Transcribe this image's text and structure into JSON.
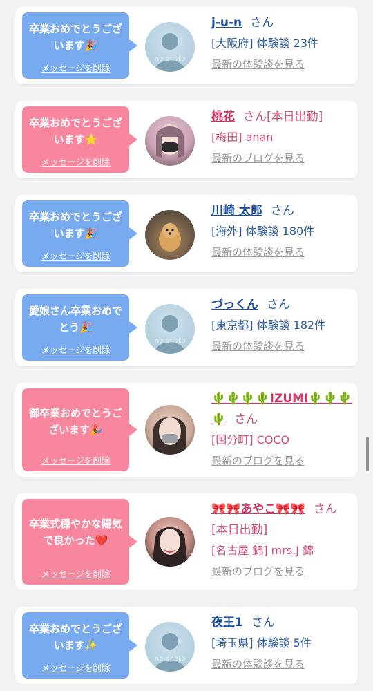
{
  "delete_label": "メッセージを削除",
  "cards": [
    {
      "bubble_text": "卒業おめでとうございます🎉",
      "name": "j-u-n",
      "san": "さん",
      "detail": "[大阪府] 体験談 23件",
      "link": "最新の体験談を見る",
      "avatar_label": "no photo"
    },
    {
      "bubble_text": "卒業おめでとうございます⭐",
      "name": "桃花",
      "san": "さん[本日出勤]",
      "detail": "[梅田] anan",
      "link": "最新のブログを見る"
    },
    {
      "bubble_text": "卒業おめでとうございます🎉",
      "name": "川崎 太郎",
      "san": "さん",
      "detail": "[海外] 体験談 180件",
      "link": "最新の体験談を見る"
    },
    {
      "bubble_text": "愛娘さん卒業おめでとう🎉",
      "name": "づっくん",
      "san": "さん",
      "detail": "[東京都] 体験談 182件",
      "link": "最新の体験談を見る",
      "avatar_label": "no photo"
    },
    {
      "bubble_text": "御卒業おめでとうございます🎉",
      "name": "🌵🌵🌵🌵IZUMI🌵🌵🌵🌵",
      "san": "さん",
      "detail": "[国分町] COCO",
      "link": "最新のブログを見る"
    },
    {
      "bubble_text": "卒業式穏やかな陽気で良かった❤️",
      "name": "🎀🎀あやこ🎀🎀",
      "san": "さん[本日出勤]",
      "detail": "[名古屋 錦] mrs.J 錦",
      "link": "最新のブログを見る"
    },
    {
      "bubble_text": "卒業おめでとうございます✨",
      "name": "夜王1",
      "san": "さん",
      "detail": "[埼玉県] 体験談 5件",
      "link": "最新の体験談を見る",
      "avatar_label": "no photo"
    }
  ],
  "colors": {
    "blue_bubble": "#78aaf0",
    "pink_bubble": "#f7869e",
    "blue_text": "#2a5aa8",
    "pink_text": "#d64a73",
    "link_gray": "#9a9a9a"
  }
}
